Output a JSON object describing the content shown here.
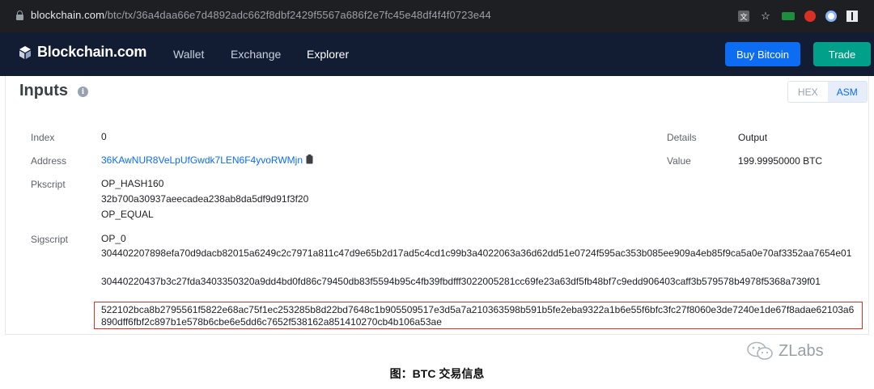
{
  "browser": {
    "url_domain": "blockchain.com",
    "url_path": "/btc/tx/36a4daa66e7d4892adc662f8dbf2429f5567a686f2e7fc45e48df4f4f0723e44"
  },
  "nav": {
    "brand": "Blockchain.com",
    "links": [
      "Wallet",
      "Exchange",
      "Explorer"
    ],
    "active": "Explorer",
    "buy_button": "Buy Bitcoin",
    "trade_button": "Trade"
  },
  "inputs": {
    "title": "Inputs",
    "info_glyph": "i",
    "toggle": {
      "hex": "HEX",
      "asm": "ASM",
      "selected": "ASM"
    },
    "index_label": "Index",
    "index_value": "0",
    "address_label": "Address",
    "address_value": "36KAwNUR8VeLpUfGwdk7LEN6F4yvoRWMjn",
    "pkscript_label": "Pkscript",
    "pkscript_lines": [
      "OP_HASH160",
      "32b700a30937aeecadea238ab8da5df9d91f3f20",
      "OP_EQUAL"
    ],
    "sigscript_label": "Sigscript",
    "sigscript_op": "OP_0",
    "sigscript_sig1": "304402207898efa70d9dacb82015a6249c2c7971a811c47d9e65b2d17ad5c4cd1c99b3a4022063a36d62dd51e0724f595ac353b085ee909a4eb85f9ca5a0e70af3352aa7654e01",
    "sigscript_sig2": "30440220437b3c27fda3403350320a9dd4bd0fd86c79450db83f5594b95c4fb39fbdfff3022005281cc69fe23a63df5fb48bf7c9edd906403caff3b579578b4978f5368a739f01",
    "sigscript_redeem": "522102bca8b2795561f5822e68ac75f1ec253285b8d22bd7648c1b905509517e3d5a7a210363598b591b5fe2eba9322a1b6e55f6bfc3fc27f8060e3de7240e1de67f8adae62103a6890dff6fbf2c897b1e578b6cbe6e5dd6c7652f538162a851410270cb4b106a53ae",
    "details_label": "Details",
    "details_value": "Output",
    "value_label": "Value",
    "value_value": "199.99950000 BTC"
  },
  "caption": "图：BTC 交易信息",
  "watermark": "ZLabs",
  "colors": {
    "navbar": "#121d33",
    "buy": "#0c6cf2",
    "trade": "#00a08a",
    "link": "#0c6cf2",
    "highlight": "#d93025"
  }
}
